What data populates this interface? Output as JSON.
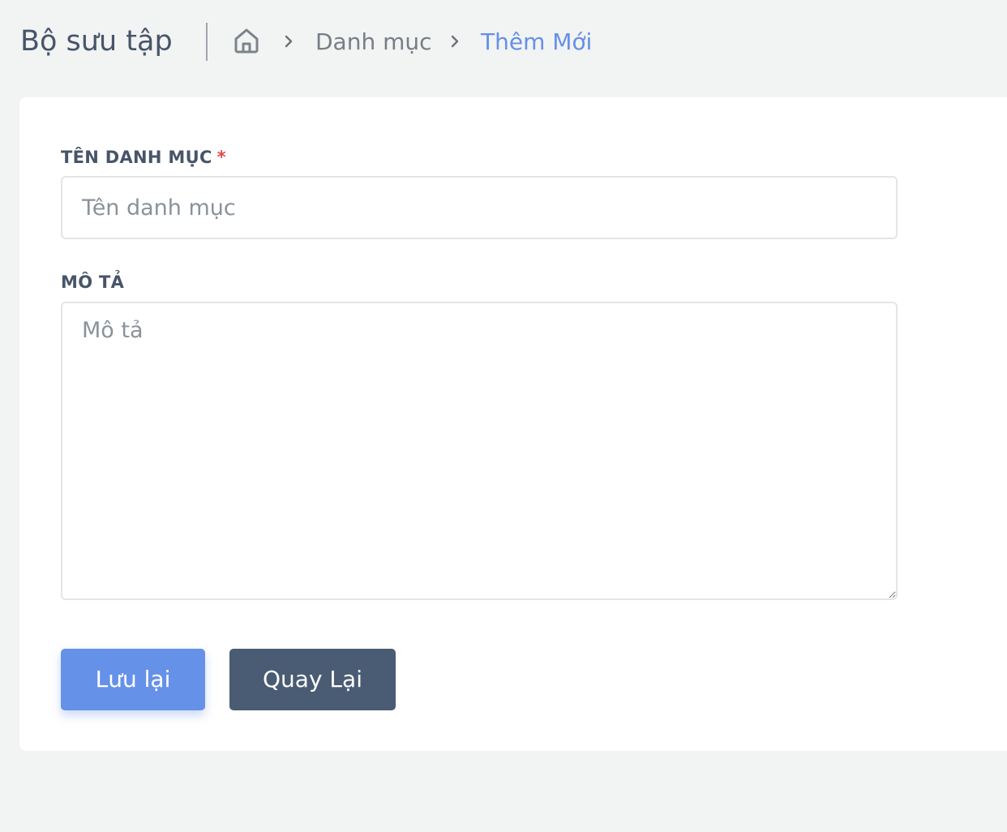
{
  "header": {
    "title": "Bộ sưu tập",
    "breadcrumb": {
      "home_icon": "home-icon",
      "separator_icon": "chevron-right-icon",
      "items": [
        {
          "label": "Danh mục"
        },
        {
          "label": "Thêm Mới"
        }
      ]
    }
  },
  "form": {
    "name_field": {
      "label": "TÊN DANH MỤC",
      "required_mark": "*",
      "value": "",
      "placeholder": "Tên danh mục"
    },
    "description_field": {
      "label": "MÔ TẢ",
      "value": "",
      "placeholder": "Mô tả"
    },
    "save_button": "Lưu lại",
    "back_button": "Quay Lại"
  },
  "colors": {
    "page_background": "#f2f3f3",
    "card_background": "#ffffff",
    "title_text": "#475569",
    "breadcrumb_text": "#777e86",
    "breadcrumb_active": "#6690e6",
    "required": "#e04b4b",
    "primary_button": "#6691e8",
    "secondary_button": "#4a5b74"
  }
}
